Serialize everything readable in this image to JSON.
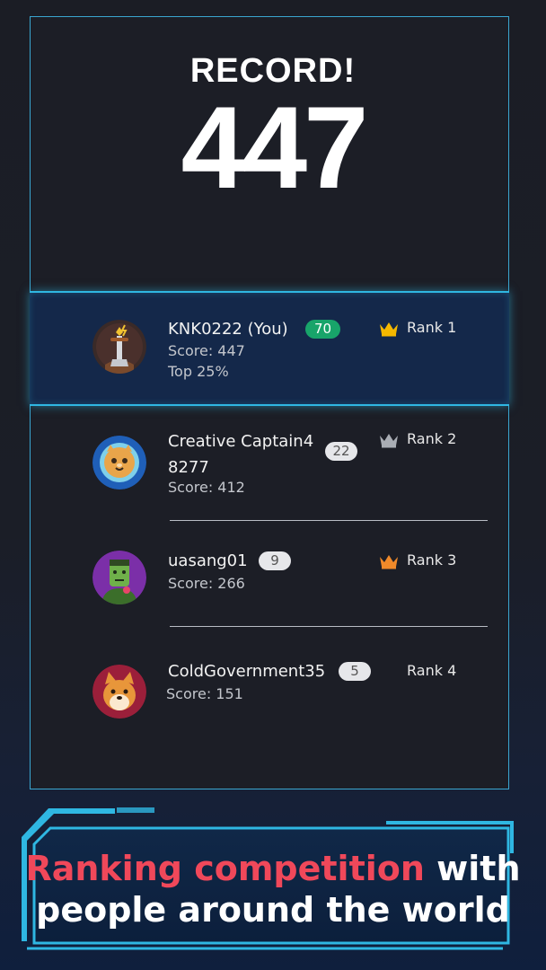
{
  "header": {
    "record_label": "RECORD!",
    "score": "447"
  },
  "leaderboard": [
    {
      "name": "KNK0222 (You)",
      "level": "70",
      "score_text": "Score: 447",
      "extra": "Top 25%",
      "rank": "Rank 1",
      "crown": "gold-crown-icon",
      "is_me": true
    },
    {
      "name_line1": "Creative Captain4",
      "name_line2": "8277",
      "level": "22",
      "score_text": "Score: 412",
      "rank": "Rank 2",
      "crown": "silver-crown-icon"
    },
    {
      "name": "uasang01",
      "level": "9",
      "score_text": "Score: 266",
      "rank": "Rank 3",
      "crown": "bronze-crown-icon"
    },
    {
      "name": "ColdGovernment35",
      "level": "5",
      "score_text": "Score: 151",
      "rank": "Rank 4"
    }
  ],
  "banner": {
    "highlight": "Ranking competition",
    "rest_line1": "with",
    "line2": "people around the world"
  },
  "colors": {
    "accent": "#3aa6d0",
    "highlight_text": "#f0485a",
    "level_green": "#18a46a",
    "gold": "#f5b800",
    "silver": "#a9adb4",
    "bronze": "#f08a2a"
  }
}
